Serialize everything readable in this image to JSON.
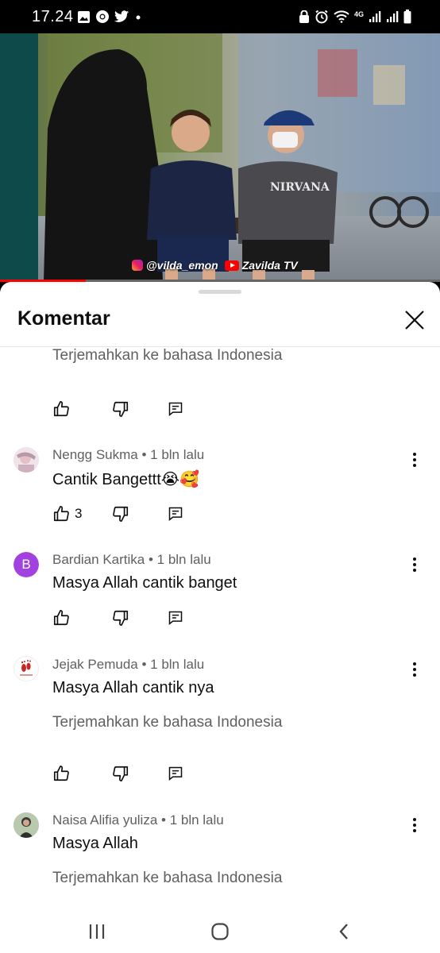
{
  "status_bar": {
    "time": "17.24",
    "left_icons": [
      "gallery-icon",
      "chrome-icon",
      "twitter-icon",
      "dot-icon"
    ],
    "right_icons": [
      "lock-icon",
      "alarm-icon",
      "wifi-icon",
      "4g-icon",
      "signal-icon",
      "signal-icon",
      "battery-icon"
    ],
    "network_label": "4G"
  },
  "video": {
    "watermark_instagram": "@vilda_emon",
    "watermark_youtube": "Zavilda TV",
    "shirt_text": "NIRVANA",
    "progress_fraction": 0.195,
    "progress_color": "#ff0000"
  },
  "comments_sheet": {
    "title": "Komentar",
    "translate_label": "Terjemahkan ke bahasa Indonesia",
    "comments": [
      {
        "author": "Nengg Sukma",
        "time": "1 bln lalu",
        "text": "Cantik Bangettt😭🥰",
        "likes": "3",
        "has_translate": false
      },
      {
        "author": "Bardian Kartika",
        "time": "1 bln lalu",
        "text": "Masya Allah cantik banget",
        "avatar_letter": "B",
        "avatar_color": "#a142e0",
        "has_translate": false
      },
      {
        "author": "Jejak Pemuda",
        "time": "1 bln lalu",
        "text": "Masya Allah cantik nya",
        "has_translate": true
      },
      {
        "author": "Naisa Alifia yuliza",
        "time": "1 bln lalu",
        "text": "Masya Allah",
        "has_translate": true
      }
    ]
  },
  "nav_bar": {
    "buttons": [
      "recents-icon",
      "home-icon",
      "back-icon"
    ]
  }
}
